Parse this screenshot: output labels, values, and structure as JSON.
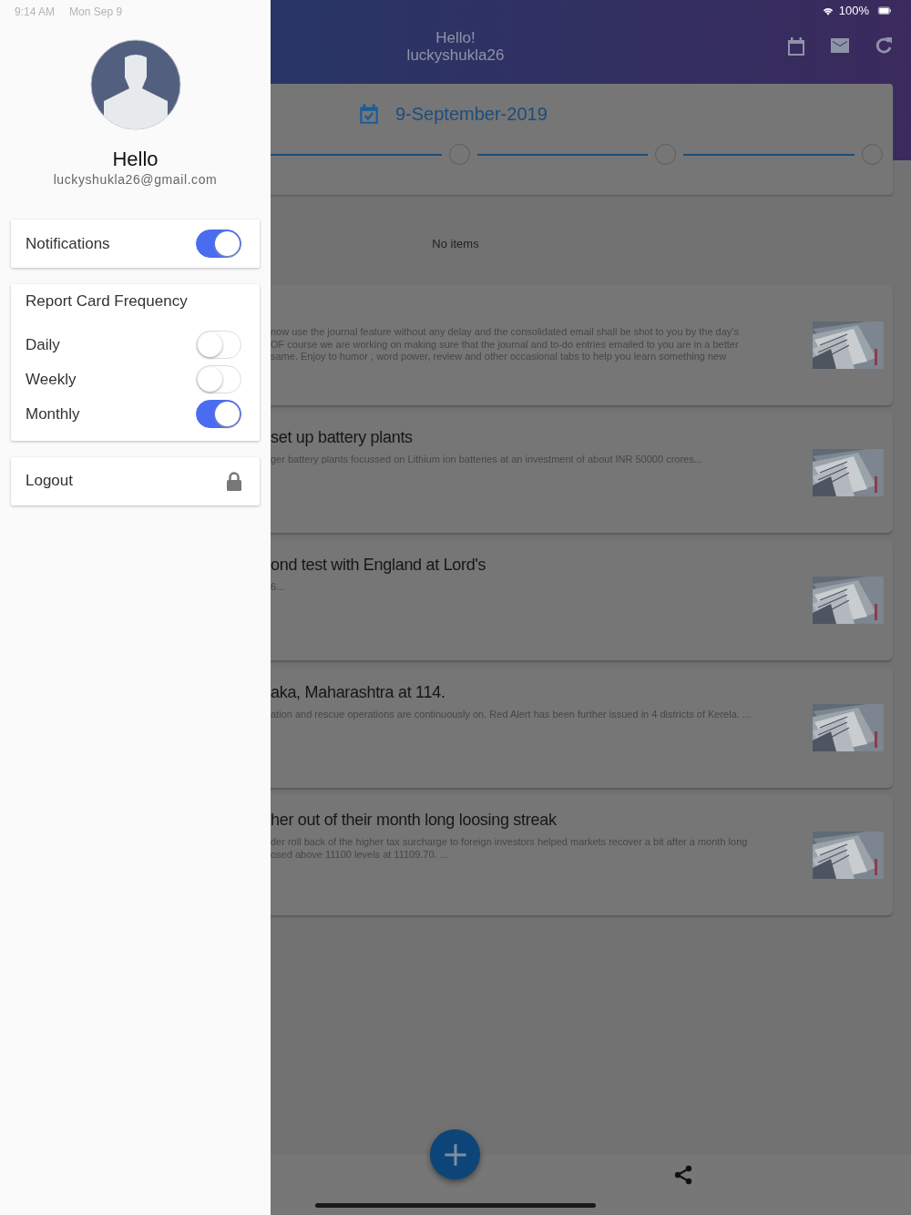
{
  "status_bar": {
    "time": "9:14 AM",
    "date": "Mon Sep 9",
    "battery": "100%"
  },
  "header": {
    "title": "Hello!",
    "subtitle": "luckyshukla26"
  },
  "date_card": {
    "date": "9-September-2019"
  },
  "empty_message": "No items",
  "news": [
    {
      "lines": [
        "now use the journal feature without any delay and the consolidated email shall be shot to you by the day's",
        "OF course we are working on making sure that the journal and to-do entries emailed to you are in a better",
        "same. Enjoy to  humor , word power, review and other occasional tabs to help you  learn something new"
      ]
    },
    {
      "title": "set up battery plants",
      "lines": [
        "ger battery plants focussed on Lithium ion batteries at an investment of about INR 50000 crores..."
      ]
    },
    {
      "title": "ond test with England at Lord's",
      "lines": [
        "6..."
      ]
    },
    {
      "title": "aka, Maharashtra at 114.",
      "lines": [
        "ation and rescue operations are continuously on. Red Alert has been further issued in 4 districts of Kerela. ..."
      ]
    },
    {
      "title": "her out of their month long loosing streak",
      "lines": [
        "der roll back of the higher tax surcharge to foreign investors helped markets recover a bit after a month long",
        "osed above 11100 levels at 11109.70. ..."
      ]
    }
  ],
  "drawer": {
    "greeting": "Hello",
    "email": "luckyshukla26@gmail.com",
    "notifications": {
      "label": "Notifications",
      "on": true
    },
    "report_card": {
      "title": "Report Card Frequency",
      "options": [
        {
          "label": "Daily",
          "on": false
        },
        {
          "label": "Weekly",
          "on": false
        },
        {
          "label": "Monthly",
          "on": true
        }
      ]
    },
    "logout": {
      "label": "Logout"
    }
  }
}
